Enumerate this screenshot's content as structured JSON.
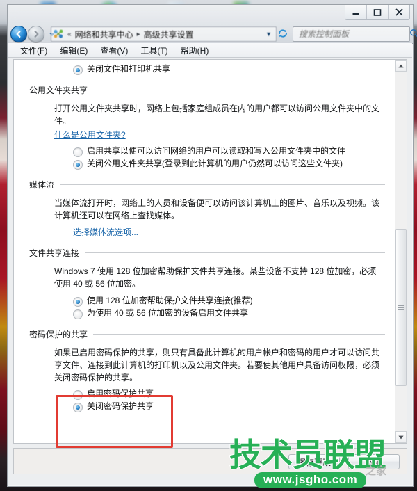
{
  "window": {
    "controls": {
      "minimize": "minimize-button",
      "maximize": "maximize-button",
      "close": "close-button"
    }
  },
  "nav": {
    "back": "back-button",
    "forward": "forward-button",
    "history_dropdown": "history-dropdown",
    "breadcrumb_prefix": "«",
    "breadcrumb": [
      {
        "label": "网络和共享中心"
      },
      {
        "label": "高级共享设置"
      }
    ],
    "separator": "▸",
    "dropdown_caret": "▼",
    "refresh": "refresh-button"
  },
  "search": {
    "placeholder": "搜索控制面板",
    "value": ""
  },
  "menubar": {
    "items": [
      {
        "label": "文件(F)"
      },
      {
        "label": "编辑(E)"
      },
      {
        "label": "查看(V)"
      },
      {
        "label": "工具(T)"
      },
      {
        "label": "帮助(H)"
      }
    ]
  },
  "content": {
    "top_partial_radio": {
      "label": "关闭文件和打印机共享",
      "checked": true
    },
    "sections": [
      {
        "title": "公用文件夹共享",
        "paragraph": "打开公用文件夹共享时，网络上包括家庭组成员在内的用户都可以访问公用文件夹中的文件。",
        "link": "什么是公用文件夹?",
        "options": [
          {
            "label": "启用共享以便可以访问网络的用户可以读取和写入公用文件夹中的文件",
            "checked": false
          },
          {
            "label": "关闭公用文件夹共享(登录到此计算机的用户仍然可以访问这些文件夹)",
            "checked": true
          }
        ]
      },
      {
        "title": "媒体流",
        "paragraph": "当媒体流打开时，网络上的人员和设备便可以访问该计算机上的图片、音乐以及视频。该计算机还可以在网络上查找媒体。",
        "link": "选择媒体流选项...",
        "options": []
      },
      {
        "title": "文件共享连接",
        "paragraph": "Windows 7 使用 128 位加密帮助保护文件共享连接。某些设备不支持 128 位加密，必须使用 40 或 56 位加密。",
        "link": "",
        "options": [
          {
            "label": "使用 128 位加密帮助保护文件共享连接(推荐)",
            "checked": true
          },
          {
            "label": "为使用 40 或 56 位加密的设备启用文件共享",
            "checked": false
          }
        ]
      },
      {
        "title": "密码保护的共享",
        "paragraph": "如果已启用密码保护的共享，则只有具备此计算机的用户帐户和密码的用户才可以访问共享文件、连接到此计算机的打印机以及公用文件夹。若要使其他用户具备访问权限，必须关闭密码保护的共享。",
        "link": "",
        "options": [
          {
            "label": "启用密码保护共享",
            "checked": false
          },
          {
            "label": "关闭密码保护共享",
            "checked": true
          }
        ]
      }
    ]
  },
  "footer": {
    "save_label": "保存更改",
    "cancel_label": "取消"
  },
  "annotation": {
    "highlight_color": "#e23b32"
  },
  "watermark": {
    "text": "技术员联盟",
    "url": "www.jsgho.com",
    "suffix": "之家"
  }
}
